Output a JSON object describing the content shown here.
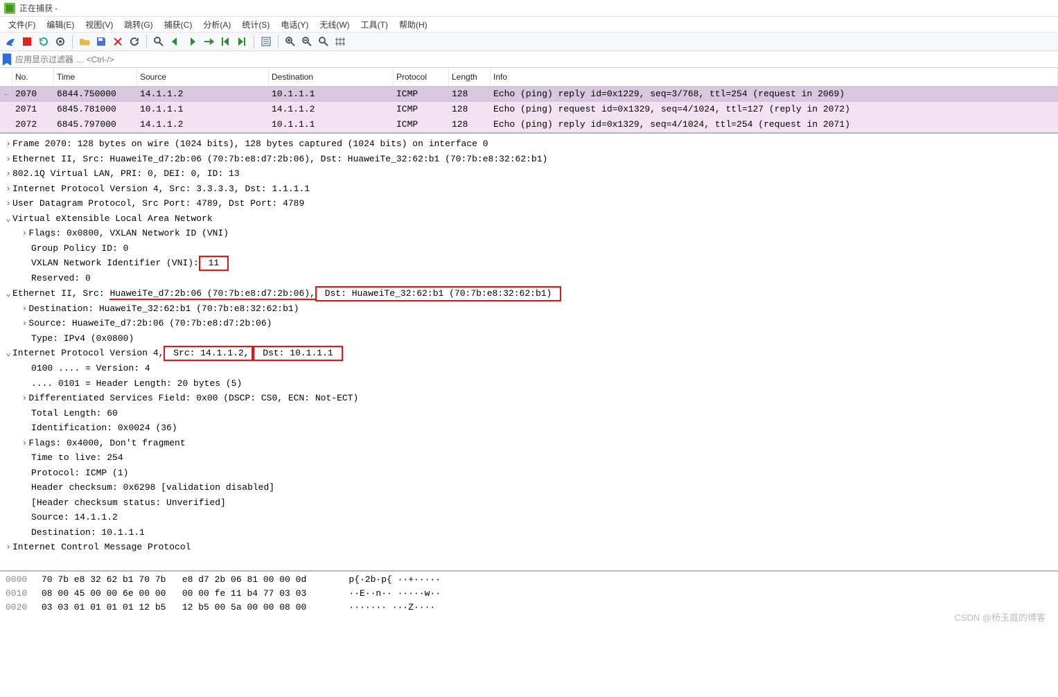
{
  "window": {
    "title": "正在捕获 -"
  },
  "menu": {
    "items": [
      "文件(F)",
      "编辑(E)",
      "视图(V)",
      "跳转(G)",
      "捕获(C)",
      "分析(A)",
      "统计(S)",
      "电话(Y)",
      "无线(W)",
      "工具(T)",
      "帮助(H)"
    ]
  },
  "toolbar_icons": [
    "shark-icon",
    "stop-icon",
    "restart-icon",
    "options-icon",
    "sep",
    "open-icon",
    "save-icon",
    "close-icon",
    "reload-icon",
    "sep",
    "find-icon",
    "back-icon",
    "forward-icon",
    "goto-icon",
    "first-icon",
    "last-icon",
    "sep",
    "autoscroll-icon",
    "sep",
    "zoom-in-icon",
    "zoom-out-icon",
    "zoom-reset-icon",
    "resize-cols-icon"
  ],
  "filter": {
    "placeholder": "应用显示过滤器 … <Ctrl-/>"
  },
  "columns": [
    "",
    "No.",
    "Time",
    "Source",
    "Destination",
    "Protocol",
    "Length",
    "Info"
  ],
  "packets": [
    {
      "arrow": "←",
      "no": "2070",
      "time": "6844.750000",
      "src": "14.1.1.2",
      "dst": "10.1.1.1",
      "proto": "ICMP",
      "len": "128",
      "info": "Echo (ping) reply    id=0x1229, seq=3/768, ttl=254 (request in 2069)",
      "cls": "sel"
    },
    {
      "arrow": "",
      "no": "2071",
      "time": "6845.781000",
      "src": "10.1.1.1",
      "dst": "14.1.1.2",
      "proto": "ICMP",
      "len": "128",
      "info": "Echo (ping) request  id=0x1329, seq=4/1024, ttl=127 (reply in 2072)",
      "cls": "alt"
    },
    {
      "arrow": "",
      "no": "2072",
      "time": "6845.797000",
      "src": "14.1.1.2",
      "dst": "10.1.1.1",
      "proto": "ICMP",
      "len": "128",
      "info": "Echo (ping) reply    id=0x1329, seq=4/1024, ttl=254 (request in 2071)",
      "cls": "alt"
    }
  ],
  "tree": {
    "l0": "Frame 2070: 128 bytes on wire (1024 bits), 128 bytes captured (1024 bits) on interface 0",
    "l1": "Ethernet II, Src: HuaweiTe_d7:2b:06 (70:7b:e8:d7:2b:06), Dst: HuaweiTe_32:62:b1 (70:7b:e8:32:62:b1)",
    "l2": "802.1Q Virtual LAN, PRI: 0, DEI: 0, ID: 13",
    "l3": "Internet Protocol Version 4, Src: 3.3.3.3, Dst: 1.1.1.1",
    "l4": "User Datagram Protocol, Src Port: 4789, Dst Port: 4789",
    "l5": "Virtual eXtensible Local Area Network",
    "l5a": "Flags: 0x0800, VXLAN Network ID (VNI)",
    "l5b": "Group Policy ID: 0",
    "l5c_pre": "VXLAN Network Identifier (VNI):",
    "l5c_val": " 11 ",
    "l5d": "Reserved: 0",
    "l6_pre": "Ethernet II, Src: ",
    "l6_u": "HuaweiTe_d7:2b:06 (70:7b:e8:d7:2b:06),",
    "l6_box": " Dst: HuaweiTe_32:62:b1 (70:7b:e8:32:62:b1) ",
    "l6a": "Destination: HuaweiTe_32:62:b1 (70:7b:e8:32:62:b1)",
    "l6b": "Source: HuaweiTe_d7:2b:06 (70:7b:e8:d7:2b:06)",
    "l6c": "Type: IPv4 (0x0800)",
    "l7_pre": "Internet Protocol Version 4,",
    "l7_src": " Src: 14.1.1.2,",
    "l7_dst": " Dst: 10.1.1.1 ",
    "l7a": "0100 .... = Version: 4",
    "l7b": ".... 0101 = Header Length: 20 bytes (5)",
    "l7c": "Differentiated Services Field: 0x00 (DSCP: CS0, ECN: Not-ECT)",
    "l7d": "Total Length: 60",
    "l7e": "Identification: 0x0024 (36)",
    "l7f": "Flags: 0x4000, Don't fragment",
    "l7g": "Time to live: 254",
    "l7h": "Protocol: ICMP (1)",
    "l7i": "Header checksum: 0x6298 [validation disabled]",
    "l7j": "[Header checksum status: Unverified]",
    "l7k": "Source: 14.1.1.2",
    "l7l": "Destination: 10.1.1.1",
    "l8": "Internet Control Message Protocol"
  },
  "hex": [
    {
      "addr": "0000",
      "bytes": "70 7b e8 32 62 b1 70 7b   e8 d7 2b 06 81 00 00 0d",
      "ascii": "   p{·2b·p{ ··+·····"
    },
    {
      "addr": "0010",
      "bytes": "08 00 45 00 00 6e 00 00   00 00 fe 11 b4 77 03 03",
      "ascii": "   ··E··n·· ·····w··"
    },
    {
      "addr": "0020",
      "bytes": "03 03 01 01 01 01 12 b5   12 b5 00 5a 00 00 08 00",
      "ascii": "   ······· ···Z····"
    }
  ],
  "watermark": "CSDN @杨玉庭的博客"
}
